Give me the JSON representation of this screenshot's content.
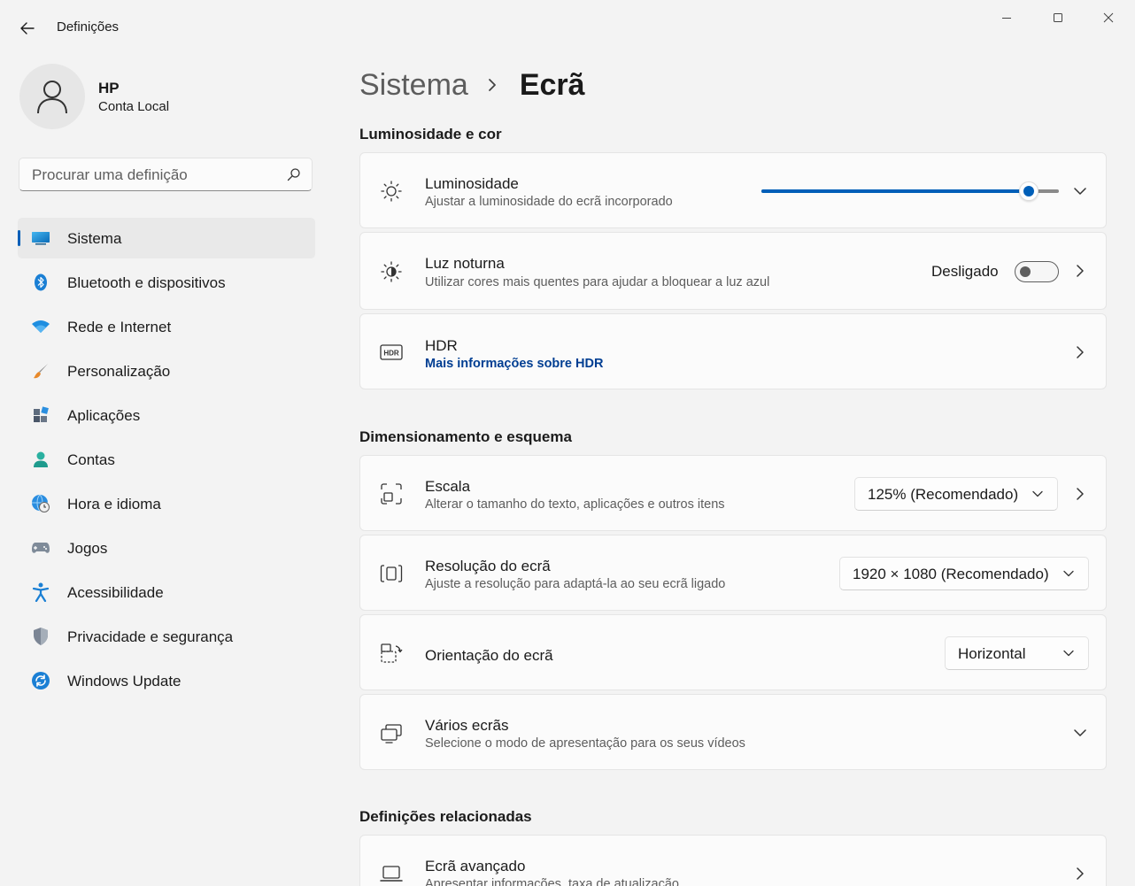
{
  "window": {
    "title": "Definições"
  },
  "profile": {
    "name": "HP",
    "account_type": "Conta Local"
  },
  "search": {
    "placeholder": "Procurar uma definição"
  },
  "sidebar": {
    "items": [
      {
        "label": "Sistema",
        "icon": "system-icon",
        "active": true
      },
      {
        "label": "Bluetooth e dispositivos",
        "icon": "bluetooth-icon"
      },
      {
        "label": "Rede e Internet",
        "icon": "wifi-icon"
      },
      {
        "label": "Personalização",
        "icon": "brush-icon"
      },
      {
        "label": "Aplicações",
        "icon": "apps-icon"
      },
      {
        "label": "Contas",
        "icon": "accounts-icon"
      },
      {
        "label": "Hora e idioma",
        "icon": "globe-clock-icon"
      },
      {
        "label": "Jogos",
        "icon": "gamepad-icon"
      },
      {
        "label": "Acessibilidade",
        "icon": "accessibility-icon"
      },
      {
        "label": "Privacidade e segurança",
        "icon": "shield-icon"
      },
      {
        "label": "Windows Update",
        "icon": "update-icon"
      }
    ]
  },
  "breadcrumb": {
    "parent": "Sistema",
    "current": "Ecrã"
  },
  "sections": {
    "brightness_color": "Luminosidade e cor",
    "scale_layout": "Dimensionamento e esquema",
    "related": "Definições relacionadas"
  },
  "brightness": {
    "title": "Luminosidade",
    "subtitle": "Ajustar a luminosidade do ecrã incorporado",
    "value_percent": 90
  },
  "night_light": {
    "title": "Luz noturna",
    "subtitle": "Utilizar cores mais quentes para ajudar a bloquear a luz azul",
    "state_label": "Desligado",
    "on": false
  },
  "hdr": {
    "title": "HDR",
    "link": "Mais informações sobre HDR",
    "icon_text": "HDR"
  },
  "scale": {
    "title": "Escala",
    "subtitle": "Alterar o tamanho do texto, aplicações e outros itens",
    "value": "125% (Recomendado)"
  },
  "resolution": {
    "title": "Resolução do ecrã",
    "subtitle": "Ajuste a resolução para adaptá-la ao seu ecrã ligado",
    "value": "1920 × 1080 (Recomendado)"
  },
  "orientation": {
    "title": "Orientação do ecrã",
    "value": "Horizontal"
  },
  "multi_display": {
    "title": "Vários ecrãs",
    "subtitle": "Selecione o modo de apresentação para os seus vídeos"
  },
  "advanced_display": {
    "title": "Ecrã avançado",
    "subtitle": "Apresentar informações, taxa de atualização"
  },
  "colors": {
    "accent": "#005fb8",
    "background": "#f3f3f3",
    "card": "#fbfbfb"
  }
}
